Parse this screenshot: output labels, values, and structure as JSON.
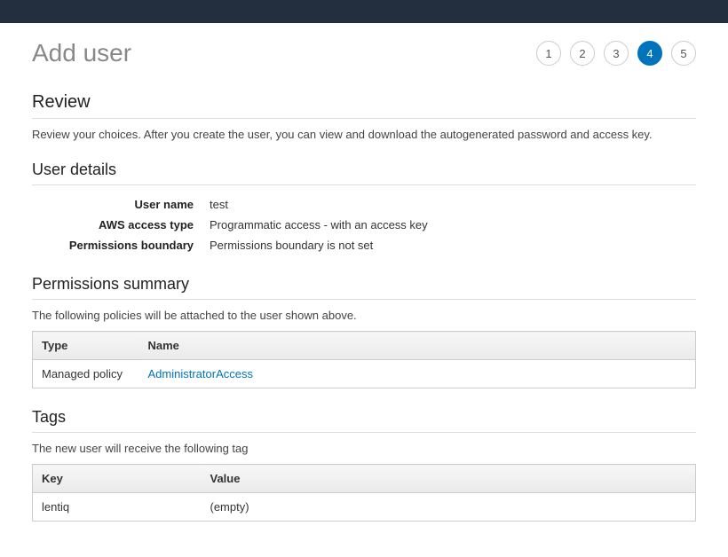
{
  "page": {
    "title": "Add user"
  },
  "steps": {
    "items": [
      "1",
      "2",
      "3",
      "4",
      "5"
    ],
    "active_index": 3
  },
  "review": {
    "heading": "Review",
    "subtext": "Review your choices. After you create the user, you can view and download the autogenerated password and access key."
  },
  "user_details": {
    "heading": "User details",
    "rows": [
      {
        "label": "User name",
        "value": "test"
      },
      {
        "label": "AWS access type",
        "value": "Programmatic access - with an access key"
      },
      {
        "label": "Permissions boundary",
        "value": "Permissions boundary is not set"
      }
    ]
  },
  "permissions_summary": {
    "heading": "Permissions summary",
    "subtext": "The following policies will be attached to the user shown above.",
    "columns": [
      "Type",
      "Name"
    ],
    "rows": [
      {
        "type": "Managed policy",
        "name": "AdministratorAccess",
        "name_is_link": true
      }
    ]
  },
  "tags": {
    "heading": "Tags",
    "subtext": "The new user will receive the following tag",
    "columns": [
      "Key",
      "Value"
    ],
    "rows": [
      {
        "key": "lentiq",
        "value": "(empty)",
        "value_empty": true
      }
    ]
  }
}
